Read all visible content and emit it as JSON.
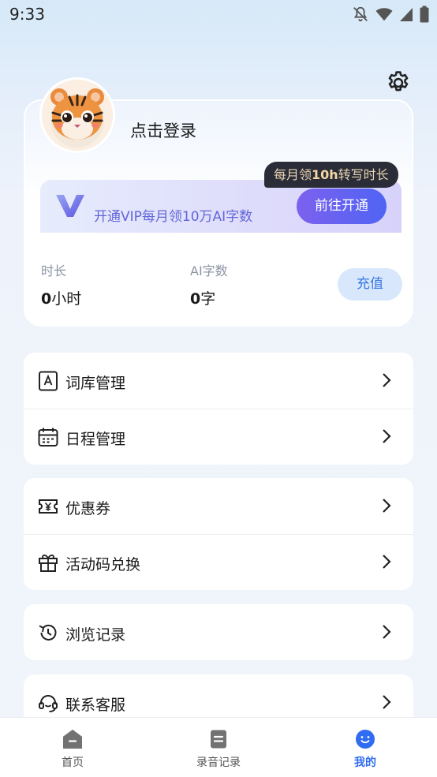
{
  "status_bar": {
    "time": "9:33"
  },
  "profile": {
    "login_label": "点击登录",
    "vip_tip_prefix": "每月领",
    "vip_tip_bold": "10h",
    "vip_tip_suffix": "转写时长",
    "vip_banner_text": "开通VIP每月领10万AI字数",
    "vip_button": "前往开通",
    "stats": [
      {
        "label": "时长",
        "value": "0",
        "unit": "小时"
      },
      {
        "label": "AI字数",
        "value": "0",
        "unit": "字"
      }
    ],
    "recharge_button": "充值"
  },
  "menu": {
    "group1": [
      {
        "label": "词库管理",
        "icon": "dictionary-icon"
      },
      {
        "label": "日程管理",
        "icon": "calendar-icon"
      }
    ],
    "group2": [
      {
        "label": "优惠券",
        "icon": "coupon-icon"
      },
      {
        "label": "活动码兑换",
        "icon": "gift-icon"
      }
    ],
    "group3": [
      {
        "label": "浏览记录",
        "icon": "history-icon"
      }
    ],
    "group4": [
      {
        "label": "联系客服",
        "icon": "headset-icon"
      }
    ]
  },
  "tabbar": {
    "tabs": [
      {
        "label": "首页",
        "icon": "home-icon",
        "active": false
      },
      {
        "label": "录音记录",
        "icon": "record-list-icon",
        "active": false
      },
      {
        "label": "我的",
        "icon": "profile-icon",
        "active": true
      }
    ]
  },
  "colors": {
    "accent": "#3a78e0",
    "active_tab": "#2f6cf2",
    "vip_purple": "#6266d8",
    "tip_dark": "#2a2d37"
  }
}
